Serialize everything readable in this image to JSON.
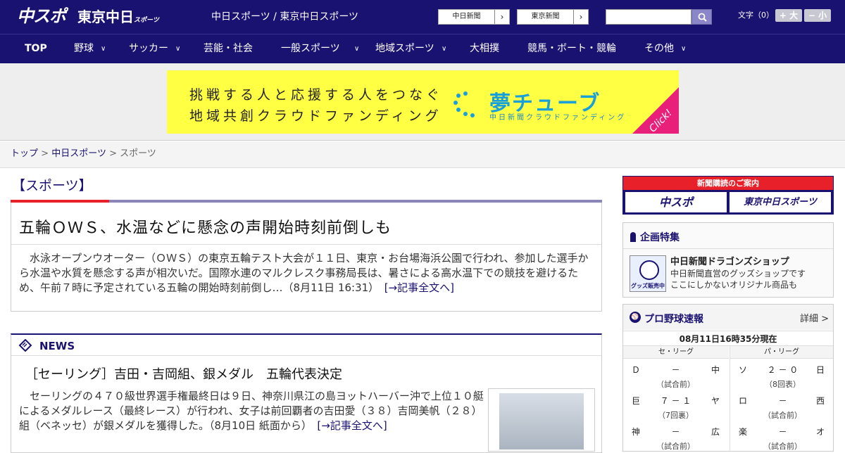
{
  "header": {
    "logo_primary": "中スポ",
    "logo_secondary": "東京中日",
    "logo_secondary_small": "スポーツ",
    "site_links": "中日スポーツ / 東京中日スポーツ",
    "paper_buttons": [
      "中日新聞",
      "東京新聞"
    ],
    "font_size_label": "文字（0）",
    "font_larger": "+ 大",
    "font_smaller": "− 小"
  },
  "nav": {
    "items": [
      {
        "label": "TOP",
        "has_menu": false
      },
      {
        "label": "野球",
        "has_menu": true
      },
      {
        "label": "サッカー",
        "has_menu": true
      },
      {
        "label": "芸能・社会",
        "has_menu": false
      },
      {
        "label": "一般スポーツ",
        "has_menu": true
      },
      {
        "label": "地域スポーツ",
        "has_menu": true
      },
      {
        "label": "大相撲",
        "has_menu": false
      },
      {
        "label": "競馬・ボート・競輪",
        "has_menu": false
      },
      {
        "label": "その他",
        "has_menu": true
      }
    ]
  },
  "banner": {
    "line1": "挑戦する人と応援する人をつなぐ",
    "line2": "地域共創クラウドファンディング",
    "brand": "夢チューブ",
    "brand_sub": "中日新聞クラウドファンディング",
    "click": "Click!",
    "colors": {
      "background": "#ffff44",
      "brand": "#1aa0d8",
      "corner": "#e8207a"
    }
  },
  "breadcrumb": {
    "items": [
      "トップ",
      "中日スポーツ",
      "スポーツ"
    ],
    "separator": ">"
  },
  "section": {
    "title": "【スポーツ】"
  },
  "top_story": {
    "headline": "五輪ＯＷＳ、水温などに懸念の声開始時刻前倒しも",
    "body": "水泳オープンウオーター（ＯＷＳ）の東京五輪テスト大会が１１日、東京・お台場海浜公園で行われ、参加した選手から水温や水質を懸念する声が相次いだ。国際水連のマルクレスク事務局長は、暑さによる高水温下での競技を避けるため、午前７時に予定されている五輪の開始時刻前倒し…（8月11日 16:31）",
    "more": "[→記事全文へ]"
  },
  "news": {
    "heading": "NEWS",
    "headline": "［セーリング］吉田・吉岡組、銀メダル　五輪代表決定",
    "body": "セーリングの４７０級世界選手権最終日は９日、神奈川県江の島ヨットハーバー沖で上位１０艇によるメダルレース（最終レース）が行われ、女子は前回覇者の吉田愛（３８）吉岡美帆（２８）組（ベネッセ）が銀メダルを獲得した。（8月10日 紙面から）",
    "more": "[→記事全文へ]"
  },
  "sidebar": {
    "subscribe": {
      "bar": "新聞購読のご案内",
      "buttons": [
        "中スポ",
        "東京中日スポーツ"
      ]
    },
    "special": {
      "title": "企画特集",
      "logo_text": "グッズ販売中",
      "name": "中日新聞ドラゴンズショップ",
      "desc1": "中日新聞直営のグッズショップです",
      "desc2": "ここにしかないオリジナル商品も"
    },
    "baseball": {
      "title": "プロ野球速報",
      "detail": "詳細 >",
      "timestamp": "08月11日16時35分現在",
      "leagues": [
        "セ・リーグ",
        "パ・リーグ"
      ],
      "central": [
        {
          "home": "Ｄ",
          "score": "－",
          "away": "中",
          "status": "（試合前）"
        },
        {
          "home": "巨",
          "score": "７ － １",
          "away": "ヤ",
          "status": "（7回裏）"
        },
        {
          "home": "神",
          "score": "－",
          "away": "広",
          "status": "（試合前）"
        }
      ],
      "pacific": [
        {
          "home": "ソ",
          "score": "２ － ０",
          "away": "日",
          "status": "（8回表）"
        },
        {
          "home": "ロ",
          "score": "－",
          "away": "西",
          "status": "（試合前）"
        },
        {
          "home": "楽",
          "score": "－",
          "away": "オ",
          "status": "（試合前）"
        }
      ]
    }
  },
  "colors": {
    "brand_navy": "#1a1270",
    "accent_red": "#e8202a"
  }
}
